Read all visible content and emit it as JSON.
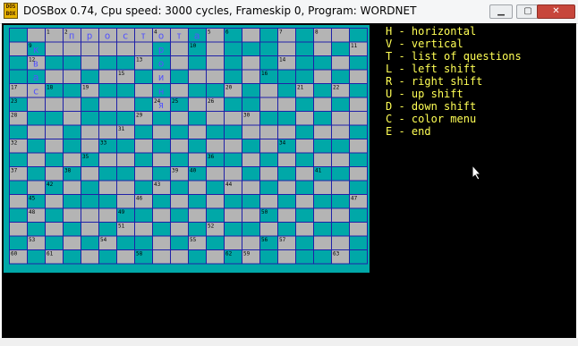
{
  "window": {
    "title": "DOSBox 0.74, Cpu speed:     3000 cycles, Frameskip  0, Program:  WORDNET",
    "icon_text": "DOS BOX",
    "minimize_label": "▁",
    "maximize_label": "▢",
    "close_label": "✕"
  },
  "crossword": {
    "rows": 17,
    "cols": 20,
    "filled_cell_color": "#b4b4b4",
    "black_cell_color": "#00a8a8",
    "grid_line_color": "#2020a8",
    "letter_color": "#5454fc",
    "black_cells": [
      [
        0,
        0
      ],
      [
        0,
        10
      ],
      [
        0,
        12
      ],
      [
        0,
        14
      ],
      [
        0,
        16
      ],
      [
        0,
        19
      ],
      [
        1,
        1
      ],
      [
        1,
        8
      ],
      [
        1,
        10
      ],
      [
        1,
        12
      ],
      [
        1,
        13
      ],
      [
        1,
        14
      ],
      [
        1,
        16
      ],
      [
        1,
        18
      ],
      [
        2,
        0
      ],
      [
        2,
        2
      ],
      [
        2,
        3
      ],
      [
        2,
        5
      ],
      [
        2,
        6
      ],
      [
        2,
        8
      ],
      [
        2,
        10
      ],
      [
        2,
        12
      ],
      [
        2,
        14
      ],
      [
        2,
        16
      ],
      [
        2,
        17
      ],
      [
        2,
        19
      ],
      [
        3,
        0
      ],
      [
        3,
        1
      ],
      [
        3,
        4
      ],
      [
        3,
        7
      ],
      [
        3,
        9
      ],
      [
        3,
        12
      ],
      [
        3,
        14
      ],
      [
        3,
        15
      ],
      [
        3,
        16
      ],
      [
        3,
        18
      ],
      [
        4,
        2
      ],
      [
        4,
        3
      ],
      [
        4,
        5
      ],
      [
        4,
        6
      ],
      [
        4,
        8
      ],
      [
        4,
        10
      ],
      [
        4,
        11
      ],
      [
        4,
        13
      ],
      [
        4,
        15
      ],
      [
        4,
        17
      ],
      [
        4,
        19
      ],
      [
        5,
        0
      ],
      [
        5,
        4
      ],
      [
        5,
        7
      ],
      [
        5,
        9
      ],
      [
        5,
        12
      ],
      [
        5,
        13
      ],
      [
        5,
        16
      ],
      [
        5,
        18
      ],
      [
        6,
        1
      ],
      [
        6,
        2
      ],
      [
        6,
        4
      ],
      [
        6,
        5
      ],
      [
        6,
        6
      ],
      [
        6,
        8
      ],
      [
        6,
        10
      ],
      [
        6,
        14
      ],
      [
        6,
        15
      ],
      [
        6,
        17
      ],
      [
        7,
        0
      ],
      [
        7,
        3
      ],
      [
        7,
        7
      ],
      [
        7,
        9
      ],
      [
        7,
        11
      ],
      [
        7,
        12
      ],
      [
        7,
        16
      ],
      [
        7,
        19
      ],
      [
        8,
        1
      ],
      [
        8,
        3
      ],
      [
        8,
        5
      ],
      [
        8,
        6
      ],
      [
        8,
        8
      ],
      [
        8,
        10
      ],
      [
        8,
        13
      ],
      [
        8,
        15
      ],
      [
        8,
        17
      ],
      [
        8,
        18
      ],
      [
        9,
        0
      ],
      [
        9,
        2
      ],
      [
        9,
        4
      ],
      [
        9,
        7
      ],
      [
        9,
        9
      ],
      [
        9,
        11
      ],
      [
        9,
        12
      ],
      [
        9,
        14
      ],
      [
        9,
        16
      ],
      [
        9,
        19
      ],
      [
        10,
        1
      ],
      [
        10,
        3
      ],
      [
        10,
        5
      ],
      [
        10,
        6
      ],
      [
        10,
        8
      ],
      [
        10,
        10
      ],
      [
        10,
        13
      ],
      [
        10,
        15
      ],
      [
        10,
        17
      ],
      [
        10,
        18
      ],
      [
        11,
        0
      ],
      [
        11,
        2
      ],
      [
        11,
        4
      ],
      [
        11,
        7
      ],
      [
        11,
        9
      ],
      [
        11,
        11
      ],
      [
        11,
        14
      ],
      [
        11,
        16
      ],
      [
        11,
        19
      ],
      [
        12,
        1
      ],
      [
        12,
        3
      ],
      [
        12,
        4
      ],
      [
        12,
        5
      ],
      [
        12,
        8
      ],
      [
        12,
        10
      ],
      [
        12,
        12
      ],
      [
        12,
        13
      ],
      [
        12,
        15
      ],
      [
        12,
        17
      ],
      [
        12,
        18
      ],
      [
        13,
        0
      ],
      [
        13,
        2
      ],
      [
        13,
        6
      ],
      [
        13,
        7
      ],
      [
        13,
        9
      ],
      [
        13,
        11
      ],
      [
        13,
        14
      ],
      [
        13,
        16
      ],
      [
        13,
        19
      ],
      [
        14,
        1
      ],
      [
        14,
        3
      ],
      [
        14,
        5
      ],
      [
        14,
        8
      ],
      [
        14,
        10
      ],
      [
        14,
        12
      ],
      [
        14,
        13
      ],
      [
        14,
        15
      ],
      [
        14,
        17
      ],
      [
        14,
        18
      ],
      [
        15,
        0
      ],
      [
        15,
        2
      ],
      [
        15,
        4
      ],
      [
        15,
        6
      ],
      [
        15,
        7
      ],
      [
        15,
        9
      ],
      [
        15,
        11
      ],
      [
        15,
        14
      ],
      [
        15,
        16
      ],
      [
        15,
        19
      ],
      [
        16,
        1
      ],
      [
        16,
        3
      ],
      [
        16,
        5
      ],
      [
        16,
        7
      ],
      [
        16,
        10
      ],
      [
        16,
        12
      ],
      [
        16,
        14
      ],
      [
        16,
        16
      ],
      [
        16,
        17
      ],
      [
        16,
        19
      ]
    ],
    "numbers": [
      {
        "r": 0,
        "c": 2,
        "n": "1"
      },
      {
        "r": 0,
        "c": 3,
        "n": "2"
      },
      {
        "r": 0,
        "c": 8,
        "n": "4"
      },
      {
        "r": 0,
        "c": 11,
        "n": "5"
      },
      {
        "r": 0,
        "c": 12,
        "n": "6"
      },
      {
        "r": 0,
        "c": 15,
        "n": "7"
      },
      {
        "r": 0,
        "c": 17,
        "n": "8"
      },
      {
        "r": 1,
        "c": 1,
        "n": "9"
      },
      {
        "r": 1,
        "c": 10,
        "n": "10"
      },
      {
        "r": 1,
        "c": 19,
        "n": "11"
      },
      {
        "r": 2,
        "c": 1,
        "n": "12"
      },
      {
        "r": 2,
        "c": 7,
        "n": "13"
      },
      {
        "r": 2,
        "c": 15,
        "n": "14"
      },
      {
        "r": 3,
        "c": 6,
        "n": "15"
      },
      {
        "r": 3,
        "c": 14,
        "n": "16"
      },
      {
        "r": 4,
        "c": 0,
        "n": "17"
      },
      {
        "r": 4,
        "c": 2,
        "n": "18"
      },
      {
        "r": 4,
        "c": 4,
        "n": "19"
      },
      {
        "r": 4,
        "c": 12,
        "n": "20"
      },
      {
        "r": 4,
        "c": 16,
        "n": "21"
      },
      {
        "r": 4,
        "c": 18,
        "n": "22"
      },
      {
        "r": 5,
        "c": 0,
        "n": "23"
      },
      {
        "r": 5,
        "c": 8,
        "n": "24"
      },
      {
        "r": 5,
        "c": 9,
        "n": "25"
      },
      {
        "r": 5,
        "c": 11,
        "n": "26"
      },
      {
        "r": 6,
        "c": 0,
        "n": "28"
      },
      {
        "r": 6,
        "c": 7,
        "n": "29"
      },
      {
        "r": 6,
        "c": 13,
        "n": "30"
      },
      {
        "r": 7,
        "c": 6,
        "n": "31"
      },
      {
        "r": 8,
        "c": 0,
        "n": "32"
      },
      {
        "r": 8,
        "c": 5,
        "n": "33"
      },
      {
        "r": 8,
        "c": 15,
        "n": "34"
      },
      {
        "r": 9,
        "c": 4,
        "n": "35"
      },
      {
        "r": 9,
        "c": 11,
        "n": "36"
      },
      {
        "r": 10,
        "c": 0,
        "n": "37"
      },
      {
        "r": 10,
        "c": 3,
        "n": "38"
      },
      {
        "r": 10,
        "c": 9,
        "n": "39"
      },
      {
        "r": 10,
        "c": 10,
        "n": "40"
      },
      {
        "r": 10,
        "c": 17,
        "n": "41"
      },
      {
        "r": 11,
        "c": 2,
        "n": "42"
      },
      {
        "r": 11,
        "c": 8,
        "n": "43"
      },
      {
        "r": 11,
        "c": 12,
        "n": "44"
      },
      {
        "r": 12,
        "c": 1,
        "n": "45"
      },
      {
        "r": 12,
        "c": 7,
        "n": "46"
      },
      {
        "r": 12,
        "c": 19,
        "n": "47"
      },
      {
        "r": 13,
        "c": 1,
        "n": "48"
      },
      {
        "r": 13,
        "c": 6,
        "n": "49"
      },
      {
        "r": 13,
        "c": 14,
        "n": "50"
      },
      {
        "r": 14,
        "c": 6,
        "n": "51"
      },
      {
        "r": 14,
        "c": 11,
        "n": "52"
      },
      {
        "r": 15,
        "c": 1,
        "n": "53"
      },
      {
        "r": 15,
        "c": 5,
        "n": "54"
      },
      {
        "r": 15,
        "c": 10,
        "n": "55"
      },
      {
        "r": 15,
        "c": 14,
        "n": "56"
      },
      {
        "r": 15,
        "c": 15,
        "n": "57"
      },
      {
        "r": 16,
        "c": 7,
        "n": "58"
      },
      {
        "r": 16,
        "c": 13,
        "n": "59"
      },
      {
        "r": 17,
        "c": 0,
        "n": "60"
      },
      {
        "r": 17,
        "c": 2,
        "n": "61"
      },
      {
        "r": 17,
        "c": 12,
        "n": "62"
      },
      {
        "r": 17,
        "c": 18,
        "n": "63"
      }
    ],
    "letters": [
      {
        "r": 0,
        "c": 3,
        "ch": "п"
      },
      {
        "r": 0,
        "c": 4,
        "ch": "р"
      },
      {
        "r": 0,
        "c": 5,
        "ch": "о"
      },
      {
        "r": 0,
        "c": 6,
        "ch": "с"
      },
      {
        "r": 0,
        "c": 7,
        "ch": "т"
      },
      {
        "r": 0,
        "c": 8,
        "ch": "о"
      },
      {
        "r": 0,
        "c": 9,
        "ch": "т"
      },
      {
        "r": 0,
        "c": 10,
        "ch": "а"
      },
      {
        "r": 1,
        "c": 1,
        "ch": "к"
      },
      {
        "r": 2,
        "c": 1,
        "ch": "в"
      },
      {
        "r": 3,
        "c": 1,
        "ch": "а"
      },
      {
        "r": 4,
        "c": 1,
        "ch": "с"
      },
      {
        "r": 1,
        "c": 8,
        "ch": "р"
      },
      {
        "r": 2,
        "c": 8,
        "ch": "о"
      },
      {
        "r": 3,
        "c": 8,
        "ch": "и"
      },
      {
        "r": 4,
        "c": 8,
        "ch": "н"
      },
      {
        "r": 5,
        "c": 8,
        "ch": "я"
      }
    ]
  },
  "legend": [
    {
      "key": "H",
      "label": "horizontal"
    },
    {
      "key": "V",
      "label": "vertical"
    },
    {
      "key": "T",
      "label": "list of questions"
    },
    {
      "key": "L",
      "label": "left shift"
    },
    {
      "key": "R",
      "label": "right shift"
    },
    {
      "key": "U",
      "label": "up shift"
    },
    {
      "key": "D",
      "label": "down shift"
    },
    {
      "key": "C",
      "label": "color menu"
    },
    {
      "key": "E",
      "label": "end"
    }
  ]
}
